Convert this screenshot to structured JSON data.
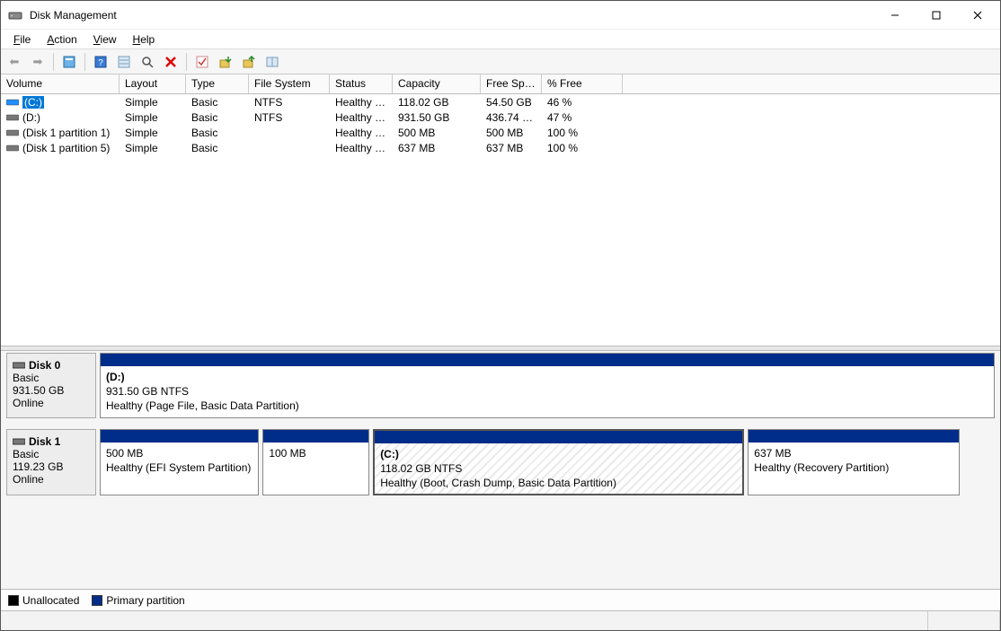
{
  "window": {
    "title": "Disk Management"
  },
  "menu": {
    "file": "File",
    "action": "Action",
    "view": "View",
    "help": "Help"
  },
  "columns": {
    "volume": "Volume",
    "layout": "Layout",
    "type": "Type",
    "fs": "File System",
    "status": "Status",
    "capacity": "Capacity",
    "free": "Free Spa...",
    "pct": "% Free"
  },
  "volumes": [
    {
      "name": "(C:)",
      "layout": "Simple",
      "type": "Basic",
      "fs": "NTFS",
      "status": "Healthy (B...",
      "capacity": "118.02 GB",
      "free": "54.50 GB",
      "pct": "46 %",
      "selected": true,
      "iconColor": "#1e90ff"
    },
    {
      "name": "(D:)",
      "layout": "Simple",
      "type": "Basic",
      "fs": "NTFS",
      "status": "Healthy (P...",
      "capacity": "931.50 GB",
      "free": "436.74 GB",
      "pct": "47 %",
      "iconColor": "#777"
    },
    {
      "name": "(Disk 1 partition 1)",
      "layout": "Simple",
      "type": "Basic",
      "fs": "",
      "status": "Healthy (E...",
      "capacity": "500 MB",
      "free": "500 MB",
      "pct": "100 %",
      "iconColor": "#777"
    },
    {
      "name": "(Disk 1 partition 5)",
      "layout": "Simple",
      "type": "Basic",
      "fs": "",
      "status": "Healthy (R...",
      "capacity": "637 MB",
      "free": "637 MB",
      "pct": "100 %",
      "iconColor": "#777"
    }
  ],
  "disks": [
    {
      "name": "Disk 0",
      "type": "Basic",
      "size": "931.50 GB",
      "status": "Online",
      "partitions": [
        {
          "label": "(D:)",
          "line2": "931.50 GB NTFS",
          "line3": "Healthy (Page File, Basic Data Partition)",
          "flex": 1,
          "selected": false
        }
      ]
    },
    {
      "name": "Disk 1",
      "type": "Basic",
      "size": "119.23 GB",
      "status": "Online",
      "partitions": [
        {
          "label": "",
          "line2": "500 MB",
          "line3": "Healthy (EFI System Partition)",
          "flex": 0.18,
          "selected": false
        },
        {
          "label": "",
          "line2": "100 MB",
          "line3": "",
          "flex": 0.12,
          "selected": false
        },
        {
          "label": "(C:)",
          "line2": "118.02 GB NTFS",
          "line3": "Healthy (Boot, Crash Dump, Basic Data Partition)",
          "flex": 0.42,
          "selected": true
        },
        {
          "label": "",
          "line2": "637 MB",
          "line3": "Healthy (Recovery Partition)",
          "flex": 0.24,
          "selected": false
        }
      ]
    }
  ],
  "legend": {
    "unallocated": "Unallocated",
    "primary": "Primary partition"
  }
}
